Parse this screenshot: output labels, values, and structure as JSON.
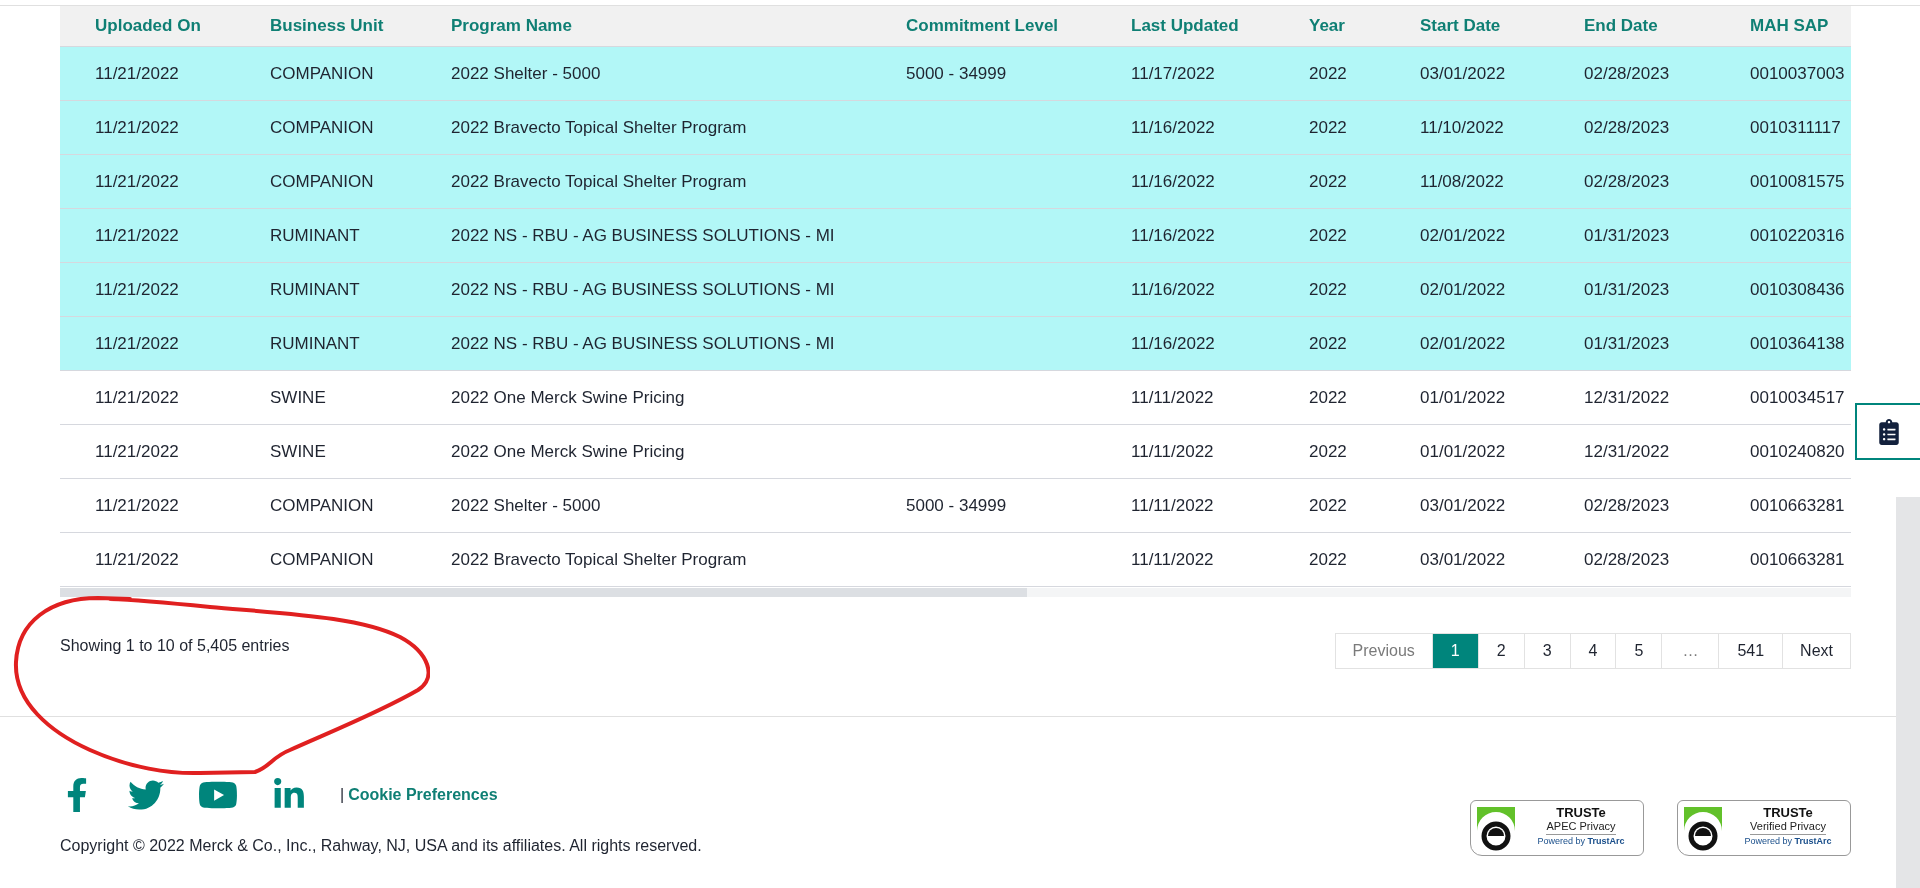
{
  "table": {
    "columns": [
      "Uploaded On",
      "Business Unit",
      "Program Name",
      "Commitment Level",
      "Last Updated",
      "Year",
      "Start Date",
      "End Date",
      "MAH SAP"
    ],
    "rows": [
      {
        "highlighted": true,
        "cells": [
          "11/21/2022",
          "COMPANION",
          "2022 Shelter - 5000",
          "5000 - 34999",
          "11/17/2022",
          "2022",
          "03/01/2022",
          "02/28/2023",
          "0010037003"
        ]
      },
      {
        "highlighted": true,
        "cells": [
          "11/21/2022",
          "COMPANION",
          "2022 Bravecto Topical Shelter Program",
          "",
          "11/16/2022",
          "2022",
          "11/10/2022",
          "02/28/2023",
          "0010311117"
        ]
      },
      {
        "highlighted": true,
        "cells": [
          "11/21/2022",
          "COMPANION",
          "2022 Bravecto Topical Shelter Program",
          "",
          "11/16/2022",
          "2022",
          "11/08/2022",
          "02/28/2023",
          "0010081575"
        ]
      },
      {
        "highlighted": true,
        "cells": [
          "11/21/2022",
          "RUMINANT",
          "2022 NS - RBU - AG BUSINESS SOLUTIONS - MI",
          "",
          "11/16/2022",
          "2022",
          "02/01/2022",
          "01/31/2023",
          "0010220316"
        ]
      },
      {
        "highlighted": true,
        "cells": [
          "11/21/2022",
          "RUMINANT",
          "2022 NS - RBU - AG BUSINESS SOLUTIONS - MI",
          "",
          "11/16/2022",
          "2022",
          "02/01/2022",
          "01/31/2023",
          "0010308436"
        ]
      },
      {
        "highlighted": true,
        "cells": [
          "11/21/2022",
          "RUMINANT",
          "2022 NS - RBU - AG BUSINESS SOLUTIONS - MI",
          "",
          "11/16/2022",
          "2022",
          "02/01/2022",
          "01/31/2023",
          "0010364138"
        ]
      },
      {
        "highlighted": false,
        "cells": [
          "11/21/2022",
          "SWINE",
          "2022 One Merck Swine Pricing",
          "",
          "11/11/2022",
          "2022",
          "01/01/2022",
          "12/31/2022",
          "0010034517"
        ]
      },
      {
        "highlighted": false,
        "cells": [
          "11/21/2022",
          "SWINE",
          "2022 One Merck Swine Pricing",
          "",
          "11/11/2022",
          "2022",
          "01/01/2022",
          "12/31/2022",
          "0010240820"
        ]
      },
      {
        "highlighted": false,
        "cells": [
          "11/21/2022",
          "COMPANION",
          "2022 Shelter - 5000",
          "5000 - 34999",
          "11/11/2022",
          "2022",
          "03/01/2022",
          "02/28/2023",
          "0010663281"
        ]
      },
      {
        "highlighted": false,
        "cells": [
          "11/21/2022",
          "COMPANION",
          "2022 Bravecto Topical Shelter Program",
          "",
          "11/11/2022",
          "2022",
          "03/01/2022",
          "02/28/2023",
          "0010663281"
        ]
      }
    ]
  },
  "entries_info": "Showing 1 to 10 of 5,405 entries",
  "pagination": {
    "previous": {
      "label": "Previous",
      "disabled": true
    },
    "pages": [
      {
        "kind": "page",
        "label": "1",
        "selected": true
      },
      {
        "kind": "page",
        "label": "2",
        "selected": false
      },
      {
        "kind": "page",
        "label": "3",
        "selected": false
      },
      {
        "kind": "page",
        "label": "4",
        "selected": false
      },
      {
        "kind": "page",
        "label": "5",
        "selected": false
      },
      {
        "kind": "ellipsis",
        "label": "…",
        "selected": false
      },
      {
        "kind": "page",
        "label": "541",
        "selected": false
      }
    ],
    "next": {
      "label": "Next",
      "disabled": false
    }
  },
  "footer": {
    "social": [
      {
        "kind": "facebook"
      },
      {
        "kind": "twitter"
      },
      {
        "kind": "youtube"
      },
      {
        "kind": "linkedin"
      }
    ],
    "separator": "|",
    "cookie_link": "Cookie Preferences",
    "copyright": "Copyright © 2022 Merck & Co., Inc., Rahway, NJ, USA and its affiliates. All rights reserved.",
    "badges": [
      {
        "title": "TRUSTe",
        "subtitle": "APEC Privacy",
        "powered": "Powered by **TrustArc**"
      },
      {
        "title": "TRUSTe",
        "subtitle": "Verified Privacy",
        "powered": "Powered by **TrustArc**"
      }
    ]
  }
}
